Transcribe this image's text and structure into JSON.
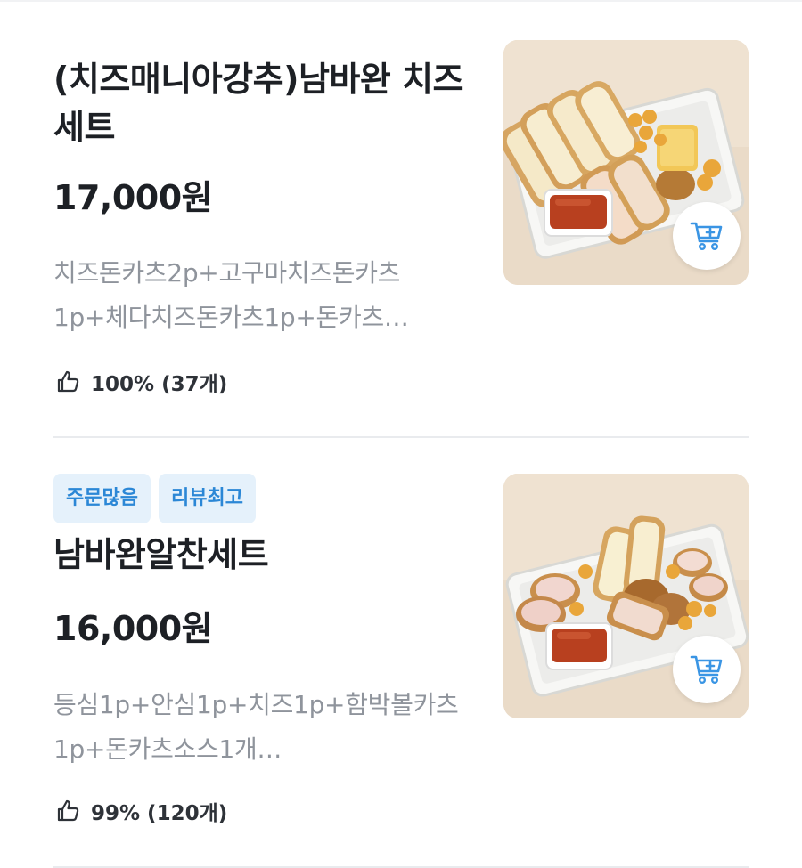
{
  "menu_items": [
    {
      "badges": [],
      "name": "(치즈매니아강추)남바완 치즈세트",
      "price": "17,000원",
      "description": "치즈돈카츠2p+고구마치즈돈카츠1p+체다치즈돈카츠1p+돈카츠…",
      "rating": "100% (37개)"
    },
    {
      "badges": [
        "주문많음",
        "리뷰최고"
      ],
      "name": "남바완알찬세트",
      "price": "16,000원",
      "description": "등심1p+안심1p+치즈1p+함박볼카츠1p+돈카츠소스1개…",
      "rating": "99% (120개)"
    }
  ],
  "colors": {
    "badge_bg": "#e5f1fb",
    "badge_text": "#2b87d6",
    "cart_icon": "#3a95e4",
    "desc_text": "#8f949c",
    "photo_bg": "#eadbc8"
  },
  "icons": {
    "rating": "thumbs-up-icon",
    "cart": "add-to-cart-icon"
  }
}
